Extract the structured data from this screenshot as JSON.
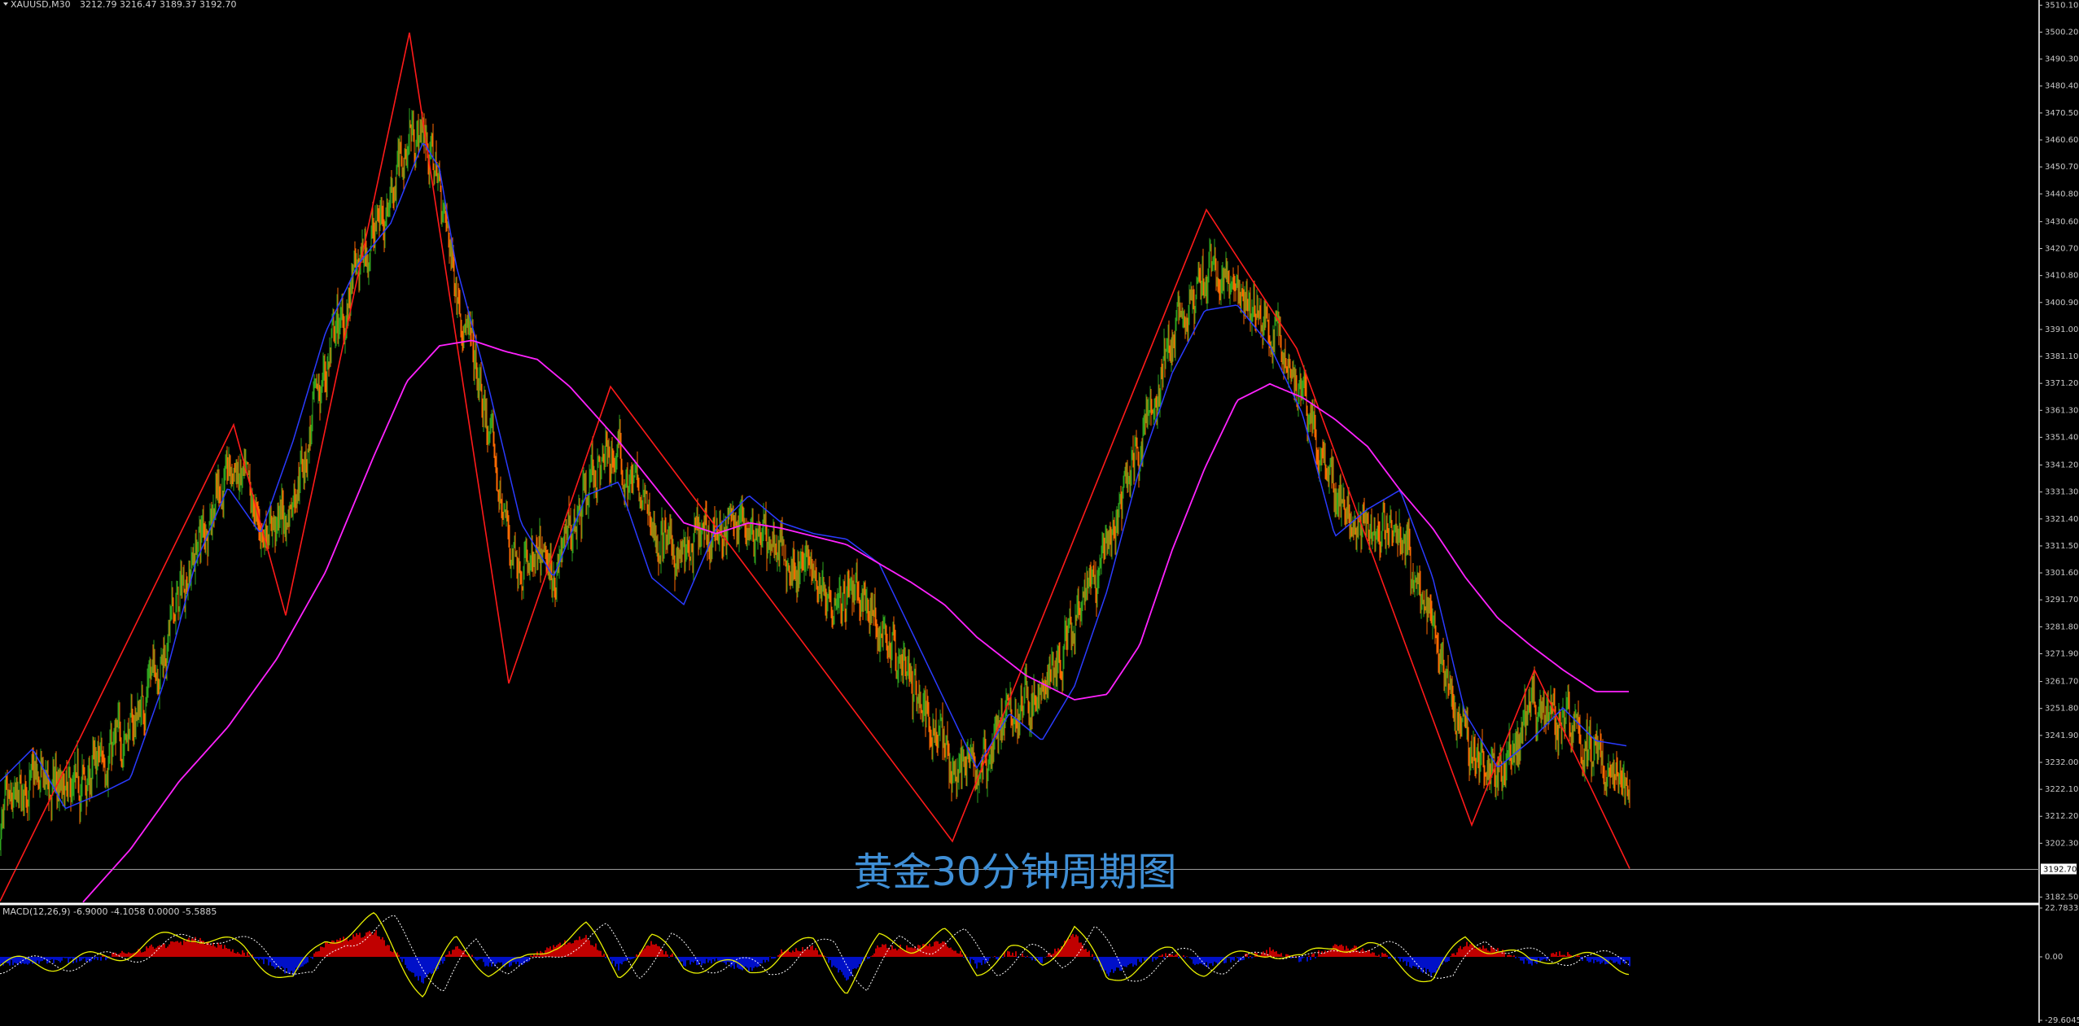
{
  "symbol_label": "XAUUSD,M30",
  "ohlc_label": "3212.79 3216.47 3189.37 3192.70",
  "watermark": "黄金30分钟周期图",
  "current_price_label": "3192.70",
  "colors": {
    "background": "#000000",
    "candle_up": "#2ea41e",
    "candle_down": "#ff6a00",
    "ma_fast": "#2a3bff",
    "ma_slow": "#ff22ff",
    "zigzag": "#ff1a1a",
    "macd_pos": "#c00000",
    "macd_neg": "#0010c8",
    "macd_line": "#e8f000",
    "signal_line": "#ffffff",
    "axis_text": "#c8c8c8"
  },
  "chart_data": [
    {
      "type": "line",
      "name": "price-panel",
      "y_tick_labels": [
        "3510.10",
        "3500.20",
        "3490.30",
        "3480.40",
        "3470.50",
        "3460.60",
        "3450.70",
        "3440.80",
        "3430.60",
        "3420.70",
        "3410.80",
        "3400.90",
        "3391.00",
        "3381.10",
        "3371.20",
        "3361.30",
        "3351.40",
        "3341.20",
        "3331.30",
        "3321.40",
        "3311.50",
        "3301.60",
        "3291.70",
        "3281.80",
        "3271.90",
        "3261.70",
        "3251.80",
        "3241.90",
        "3232.00",
        "3222.10",
        "3212.20",
        "3202.30",
        "3182.50"
      ],
      "ylim": [
        3180,
        3512
      ],
      "zigzag": {
        "x_index": [
          0,
          287,
          351,
          503,
          625,
          750,
          1170,
          1482,
          1593,
          1808,
          1885,
          2002
        ],
        "y": [
          3181,
          3356,
          3286,
          3500,
          3261,
          3370,
          3203,
          3435,
          3384,
          3209,
          3266,
          3193
        ]
      },
      "ma_fast_points": {
        "x_index": [
          0,
          40,
          80,
          120,
          160,
          200,
          240,
          280,
          320,
          360,
          400,
          440,
          480,
          520,
          540,
          560,
          600,
          640,
          680,
          720,
          760,
          800,
          840,
          880,
          920,
          960,
          1000,
          1040,
          1080,
          1120,
          1160,
          1200,
          1240,
          1280,
          1320,
          1360,
          1400,
          1440,
          1480,
          1520,
          1560,
          1600,
          1640,
          1680,
          1720,
          1760,
          1800,
          1840,
          1880,
          1920,
          1960,
          2000
        ],
        "y": [
          3225,
          3237,
          3215,
          3220,
          3226,
          3260,
          3305,
          3333,
          3316,
          3350,
          3390,
          3415,
          3430,
          3460,
          3450,
          3415,
          3370,
          3320,
          3300,
          3330,
          3335,
          3300,
          3290,
          3318,
          3330,
          3320,
          3316,
          3314,
          3305,
          3280,
          3255,
          3230,
          3250,
          3240,
          3260,
          3295,
          3340,
          3375,
          3398,
          3400,
          3385,
          3360,
          3315,
          3325,
          3332,
          3300,
          3250,
          3230,
          3240,
          3252,
          3240,
          3238
        ]
      },
      "ma_slow_points": {
        "x_index": [
          100,
          160,
          220,
          280,
          340,
          400,
          460,
          500,
          540,
          580,
          620,
          660,
          700,
          760,
          800,
          840,
          880,
          920,
          960,
          1000,
          1040,
          1080,
          1120,
          1160,
          1200,
          1260,
          1320,
          1360,
          1400,
          1440,
          1480,
          1520,
          1560,
          1600,
          1640,
          1680,
          1720,
          1760,
          1800,
          1840,
          1880,
          1920,
          1960,
          2002
        ],
        "y": [
          3180,
          3200,
          3225,
          3245,
          3270,
          3302,
          3345,
          3372,
          3385,
          3387,
          3383,
          3380,
          3370,
          3350,
          3335,
          3320,
          3316,
          3320,
          3318,
          3315,
          3312,
          3305,
          3298,
          3290,
          3278,
          3264,
          3255,
          3257,
          3275,
          3310,
          3340,
          3365,
          3371,
          3366,
          3358,
          3348,
          3332,
          3318,
          3300,
          3285,
          3275,
          3266,
          3258,
          3258
        ]
      }
    },
    {
      "type": "bar",
      "name": "macd-panel",
      "title": "MACD(12,26,9) -6.9000 -4.1058 0.0000 -5.5885",
      "y_tick_labels": [
        "22.7833",
        "0.00",
        "-29.6045"
      ],
      "ylim": [
        -29.6045,
        22.7833
      ],
      "histogram_sign_profile": {
        "x_index": [
          0,
          60,
          120,
          180,
          240,
          300,
          360,
          400,
          460,
          520,
          560,
          600,
          640,
          680,
          720,
          760,
          800,
          840,
          880,
          920,
          960,
          1000,
          1040,
          1080,
          1120,
          1160,
          1200,
          1240,
          1280,
          1320,
          1360,
          1400,
          1440,
          1480,
          1520,
          1560,
          1600,
          1640,
          1680,
          1720,
          1760,
          1800,
          1840,
          1880,
          1920,
          1960,
          2000
        ],
        "y": [
          -3,
          -2,
          -1,
          4,
          8,
          2,
          -8,
          6,
          12,
          -12,
          5,
          -4,
          -3,
          5,
          9,
          -5,
          6,
          -3,
          -2,
          -6,
          2,
          4,
          -10,
          5,
          4,
          7,
          -4,
          2,
          -2,
          10,
          -8,
          -2,
          1,
          -4,
          -1,
          3,
          -2,
          5,
          3,
          -2,
          -8,
          6,
          3,
          -3,
          2,
          -2,
          -3
        ]
      }
    }
  ]
}
